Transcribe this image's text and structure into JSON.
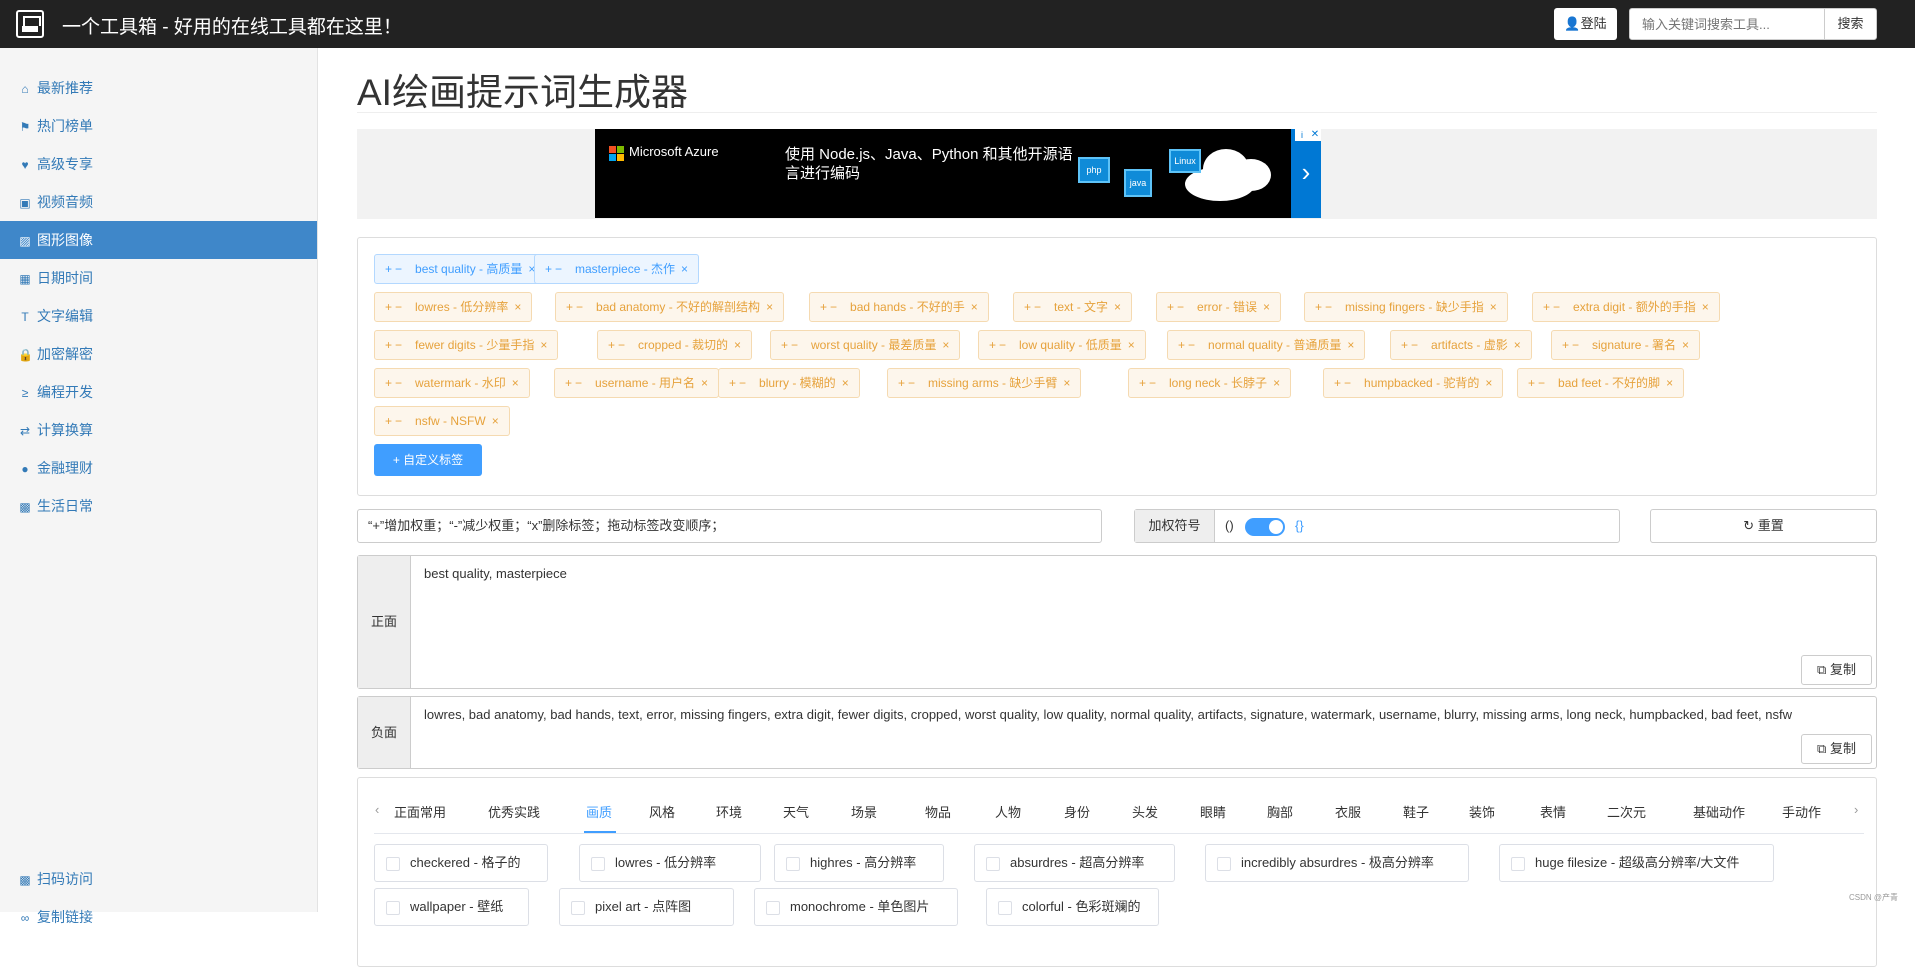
{
  "header": {
    "title": "一个工具箱 - 好用的在线工具都在这里！",
    "login_label": "登陆",
    "search_placeholder": "输入关键词搜索工具...",
    "search_button": "搜索"
  },
  "sidebar": {
    "items": [
      {
        "label": "最新推荐",
        "icon": "home-icon",
        "glyph": "⌂"
      },
      {
        "label": "热门榜单",
        "icon": "flag-icon",
        "glyph": "⚑"
      },
      {
        "label": "高级专享",
        "icon": "heart-icon",
        "glyph": "♥"
      },
      {
        "label": "视频音频",
        "icon": "film-icon",
        "glyph": "▣"
      },
      {
        "label": "图形图像",
        "icon": "picture-icon",
        "glyph": "▨"
      },
      {
        "label": "日期时间",
        "icon": "calendar-icon",
        "glyph": "▦"
      },
      {
        "label": "文字编辑",
        "icon": "text-height-icon",
        "glyph": "T"
      },
      {
        "label": "加密解密",
        "icon": "lock-icon",
        "glyph": "🔒"
      },
      {
        "label": "编程开发",
        "icon": "terminal-icon",
        "glyph": "≥"
      },
      {
        "label": "计算换算",
        "icon": "exchange-icon",
        "glyph": "⇄"
      },
      {
        "label": "金融理财",
        "icon": "piggy-bank-icon",
        "glyph": "●"
      },
      {
        "label": "生活日常",
        "icon": "qrcode-icon",
        "glyph": "▩"
      }
    ],
    "active_index": 4,
    "bottom_items": [
      {
        "label": "扫码访问",
        "icon": "qrcode-icon",
        "glyph": "▩"
      },
      {
        "label": "复制链接",
        "icon": "link-icon",
        "glyph": "∞"
      }
    ]
  },
  "main": {
    "page_title": "AI绘画提示词生成器",
    "ad": {
      "brand": "Microsoft Azure",
      "text": "使用 Node.js、Java、Python 和其他开源语言进行编码",
      "cube1": "php",
      "cube2": "Linux",
      "cube3": "java",
      "next_arrow": "›",
      "close": "✕",
      "info": "i"
    },
    "tag_pm": "+−",
    "tag_close": "×",
    "positive_tags": [
      "best quality - 高质量",
      "masterpiece - 杰作"
    ],
    "negative_tags": [
      "lowres - 低分辨率",
      "bad anatomy - 不好的解剖结构",
      "bad hands - 不好的手",
      "text - 文字",
      "error - 错误",
      "missing fingers - 缺少手指",
      "extra digit - 额外的手指",
      "fewer digits - 少量手指",
      "cropped - 裁切的",
      "worst quality - 最差质量",
      "low quality - 低质量",
      "normal quality - 普通质量",
      "artifacts - 虚影",
      "signature - 署名",
      "watermark - 水印",
      "username - 用户名",
      "blurry - 模糊的",
      "missing arms - 缺少手臂",
      "long neck - 长脖子",
      "humpbacked - 驼背的",
      "bad feet - 不好的脚",
      "nsfw - NSFW"
    ],
    "custom_tag_button": "+ 自定义标签",
    "hint": "“+”增加权重；“-”减少权重；“x”删除标签；拖动标签改变顺序；",
    "weight_label": "加权符号",
    "weight_paren": "()",
    "weight_brace": "{}",
    "weight_toggle_on": true,
    "reset_button": "↻ 重置",
    "positive": {
      "label": "正面",
      "text": "best quality, masterpiece",
      "copy": "⧉ 复制"
    },
    "negative": {
      "label": "负面",
      "text": "lowres, bad anatomy, bad hands, text, error, missing fingers, extra digit, fewer digits, cropped, worst quality, low quality, normal quality, artifacts, signature, watermark, username, blurry, missing arms, long neck, humpbacked, bad feet, nsfw",
      "copy": "⧉ 复制"
    },
    "tabs": [
      "正面常用",
      "优秀实践",
      "画质",
      "风格",
      "环境",
      "天气",
      "场景",
      "物品",
      "人物",
      "身份",
      "头发",
      "眼睛",
      "胸部",
      "衣服",
      "鞋子",
      "装饰",
      "表情",
      "二次元",
      "基础动作",
      "手动作"
    ],
    "active_tab": 2,
    "tab_prev": "‹",
    "tab_next": "›",
    "options": [
      "checkered - 格子的",
      "lowres - 低分辨率",
      "highres - 高分辨率",
      "absurdres - 超高分辨率",
      "incredibly absurdres - 极高分辨率",
      "huge filesize - 超级高分辨率/大文件",
      "wallpaper - 壁纸",
      "pixel art - 点阵图",
      "monochrome - 单色图片",
      "colorful - 色彩斑斓的"
    ]
  },
  "watermark": "CSDN @产青",
  "colors": {
    "active_nav": "#3f87c9",
    "primary": "#409eff",
    "tag_warning": "#e6a23c",
    "topbar": "#222222"
  }
}
